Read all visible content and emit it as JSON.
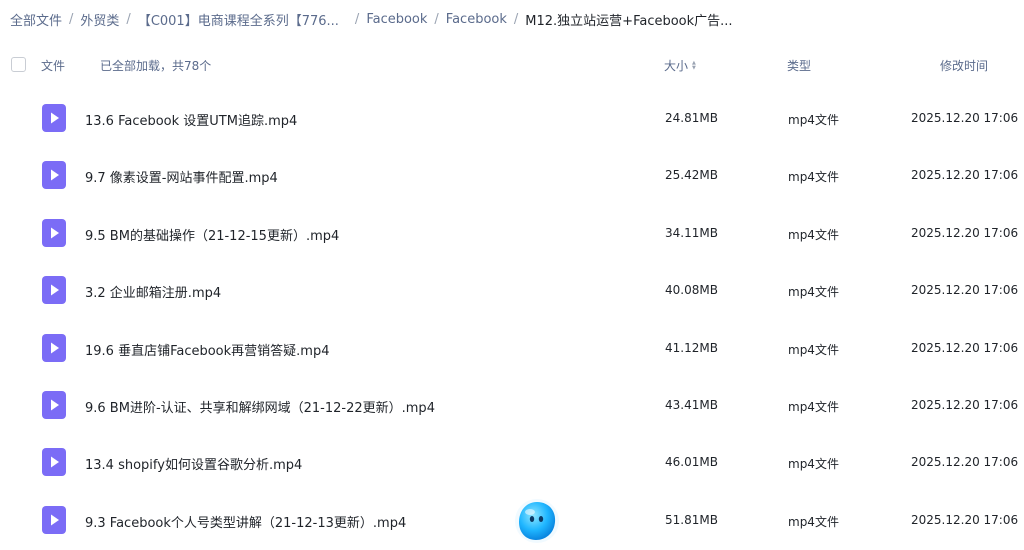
{
  "breadcrumb": [
    {
      "label": "全部文件"
    },
    {
      "label": "外贸类"
    },
    {
      "label": "【C001】电商课程全系列【776..."
    },
    {
      "label": "Facebook"
    },
    {
      "label": "Facebook"
    },
    {
      "label": "M12.独立站运营+Facebook广告..."
    }
  ],
  "header": {
    "name": "文件",
    "status": "已全部加载，共78个",
    "size": "大小",
    "type": "类型",
    "mtime": "修改时间"
  },
  "files": [
    {
      "name": "13.6 Facebook 设置UTM追踪.mp4",
      "size": "24.81MB",
      "type": "mp4文件",
      "mtime": "2025.12.20 17:06"
    },
    {
      "name": "9.7 像素设置-网站事件配置.mp4",
      "size": "25.42MB",
      "type": "mp4文件",
      "mtime": "2025.12.20 17:06"
    },
    {
      "name": "9.5 BM的基础操作（21-12-15更新）.mp4",
      "size": "34.11MB",
      "type": "mp4文件",
      "mtime": "2025.12.20 17:06"
    },
    {
      "name": "3.2 企业邮箱注册.mp4",
      "size": "40.08MB",
      "type": "mp4文件",
      "mtime": "2025.12.20 17:06"
    },
    {
      "name": "19.6 垂直店铺Facebook再营销答疑.mp4",
      "size": "41.12MB",
      "type": "mp4文件",
      "mtime": "2025.12.20 17:06"
    },
    {
      "name": "9.6 BM进阶-认证、共享和解绑网域（21-12-22更新）.mp4",
      "size": "43.41MB",
      "type": "mp4文件",
      "mtime": "2025.12.20 17:06"
    },
    {
      "name": "13.4 shopify如何设置谷歌分析.mp4",
      "size": "46.01MB",
      "type": "mp4文件",
      "mtime": "2025.12.20 17:06"
    },
    {
      "name": "9.3 Facebook个人号类型讲解（21-12-13更新）.mp4",
      "size": "51.81MB",
      "type": "mp4文件",
      "mtime": "2025.12.20 17:06"
    }
  ],
  "colors": {
    "file_icon": "#7b6cf6",
    "accent": "#06a7ff"
  },
  "icons": {
    "file": "video-file-icon",
    "sort": "sort-icon",
    "assistant": "assistant-mascot-icon"
  }
}
